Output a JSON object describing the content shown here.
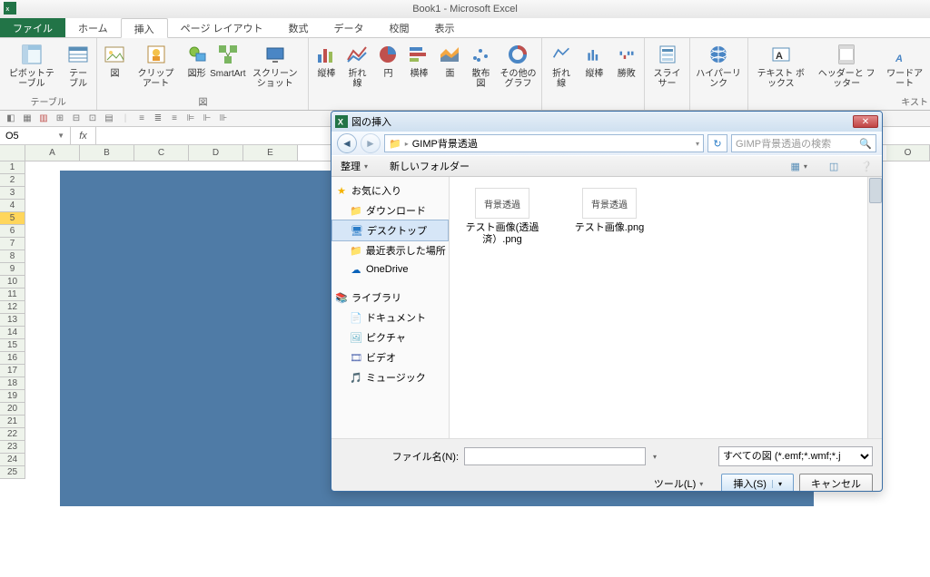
{
  "app": {
    "title": "Book1 - Microsoft Excel"
  },
  "tabs": {
    "file": "ファイル",
    "home": "ホーム",
    "insert": "挿入",
    "pageLayout": "ページ レイアウト",
    "formulas": "数式",
    "data": "データ",
    "review": "校閲",
    "view": "表示"
  },
  "ribbon": {
    "pivotTable": "ピボットテーブル",
    "table": "テーブル",
    "groupTables": "テーブル",
    "picture": "図",
    "clipArt": "クリップ\nアート",
    "shapes": "図形",
    "smartArt": "SmartArt",
    "screenshot": "スクリーン\nショット",
    "groupIllust": "図",
    "columnChart": "縦棒",
    "lineChart": "折れ線",
    "pie": "円",
    "bar": "横棒",
    "area": "面",
    "scatter": "散布図",
    "other": "その他の\nグラフ",
    "sparkLine": "折れ線",
    "sparkColumn": "縦棒",
    "sparkWinLoss": "勝敗",
    "slicer": "スライサー",
    "hyperlink": "ハイパーリンク",
    "textBox": "テキスト\nボックス",
    "headerFooter": "ヘッダーと\nフッター",
    "wordArt": "ワードアート",
    "cutoff": "キスト"
  },
  "namebox": "O5",
  "cols": [
    "A",
    "B",
    "C",
    "D",
    "E"
  ],
  "rows": [
    "1",
    "2",
    "3",
    "4",
    "5",
    "6",
    "7",
    "8",
    "9",
    "10",
    "11",
    "12",
    "13",
    "14",
    "15",
    "16",
    "17",
    "18",
    "19",
    "20",
    "21",
    "22",
    "23",
    "24",
    "25"
  ],
  "selRowIdx": 4,
  "rightCol": "O",
  "dialog": {
    "title": "図の挿入",
    "path": "GIMP背景透過",
    "searchPlaceholder": "GIMP背景透過の検索",
    "organize": "整理",
    "newFolder": "新しいフォルダー",
    "tree": [
      {
        "section": "favorites",
        "label": "お気に入り",
        "icon": "star",
        "color": "#f5b301"
      },
      {
        "key": "downloads",
        "label": "ダウンロード",
        "icon": "folder",
        "color": "#f4c24b"
      },
      {
        "key": "desktop",
        "label": "デスクトップ",
        "icon": "desktop",
        "color": "#2a7cc7",
        "selected": true
      },
      {
        "key": "recent",
        "label": "最近表示した場所",
        "icon": "folder",
        "color": "#c9a25a"
      },
      {
        "key": "onedrive",
        "label": "OneDrive",
        "icon": "cloud",
        "color": "#0a62b9"
      }
    ],
    "tree2": [
      {
        "section": "libraries",
        "label": "ライブラリ",
        "icon": "library",
        "color": "#e8a33d"
      },
      {
        "key": "documents",
        "label": "ドキュメント",
        "icon": "doc",
        "color": "#6fa1c7"
      },
      {
        "key": "pictures",
        "label": "ピクチャ",
        "icon": "pic",
        "color": "#5fb0c7"
      },
      {
        "key": "videos",
        "label": "ビデオ",
        "icon": "vid",
        "color": "#5a6fb3"
      },
      {
        "key": "music",
        "label": "ミュージック",
        "icon": "music",
        "color": "#e89a2e"
      }
    ],
    "files": [
      {
        "thumbText": "背景透過",
        "name": "テスト画像(透過済）.png"
      },
      {
        "thumbText": "背景透過",
        "name": "テスト画像.png"
      }
    ],
    "filenameLabel": "ファイル名(N):",
    "filter": "すべての図 (*.emf;*.wmf;*.j",
    "tools": "ツール(L)",
    "insert": "挿入(S)",
    "cancel": "キャンセル"
  }
}
